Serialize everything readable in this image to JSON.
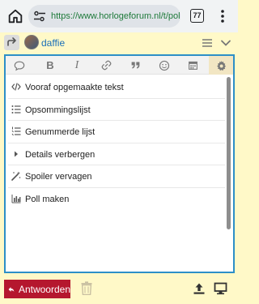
{
  "browser": {
    "url": "https://www.horlogeforum.nl/t/poll-aan",
    "tab_count": "77"
  },
  "composer": {
    "user_name": "daffie",
    "reply_icon": "reply-arrow-icon",
    "menu_icon": "hamburger-icon",
    "collapse_icon": "chevron-down-icon"
  },
  "toolbar": {
    "buttons": [
      "speech-bubble-icon",
      "bold-icon",
      "italic-icon",
      "link-icon",
      "quote-icon",
      "emoji-icon",
      "calendar-icon",
      "gear-icon"
    ],
    "active": "gear-icon",
    "bold_glyph": "B",
    "italic_glyph": "I"
  },
  "options_menu": {
    "items": [
      {
        "label": "Vooraf opgemaakte tekst",
        "icon": "code-icon"
      },
      {
        "label": "Opsommingslijst",
        "icon": "bullet-list-icon"
      },
      {
        "label": "Genummerde lijst",
        "icon": "numbered-list-icon"
      },
      {
        "label": "Details verbergen",
        "icon": "caret-right-icon"
      },
      {
        "label": "Spoiler vervagen",
        "icon": "magic-wand-icon"
      },
      {
        "label": "Poll maken",
        "icon": "bar-chart-icon"
      }
    ]
  },
  "footer": {
    "reply_label": "Antwoorden"
  },
  "colors": {
    "accent": "#2d8fc7",
    "reply_button": "#b5172e",
    "composer_bg": "#fff9c8",
    "url_green": "#1e7a3a",
    "username": "#1a6fb8"
  }
}
